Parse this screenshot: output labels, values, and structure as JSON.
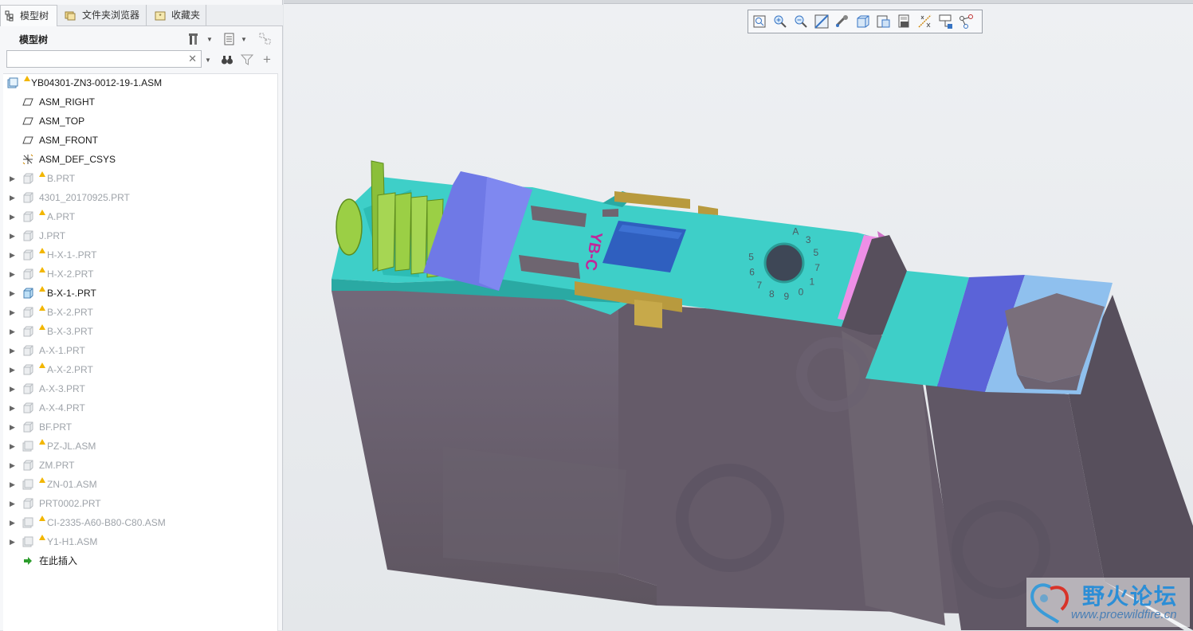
{
  "tabs": [
    {
      "label": "模型树",
      "active": true
    },
    {
      "label": "文件夹浏览器",
      "active": false
    },
    {
      "label": "收藏夹",
      "active": false
    }
  ],
  "panel": {
    "title": "模型树"
  },
  "search": {
    "value": "",
    "placeholder": ""
  },
  "tree": {
    "root": "YB04301-ZN3-0012-19-1.ASM",
    "datums": [
      "ASM_RIGHT",
      "ASM_TOP",
      "ASM_FRONT",
      "ASM_DEF_CSYS"
    ],
    "items": [
      {
        "label": "B.PRT",
        "warn": true,
        "suppressed": true,
        "type": "part"
      },
      {
        "label": "4301_20170925.PRT",
        "warn": false,
        "suppressed": true,
        "type": "part"
      },
      {
        "label": "A.PRT",
        "warn": true,
        "suppressed": true,
        "type": "part"
      },
      {
        "label": "J.PRT",
        "warn": false,
        "suppressed": true,
        "type": "part"
      },
      {
        "label": "H-X-1-.PRT",
        "warn": true,
        "suppressed": true,
        "type": "part"
      },
      {
        "label": "H-X-2.PRT",
        "warn": true,
        "suppressed": true,
        "type": "part"
      },
      {
        "label": "B-X-1-.PRT",
        "warn": true,
        "suppressed": false,
        "type": "part"
      },
      {
        "label": "B-X-2.PRT",
        "warn": true,
        "suppressed": true,
        "type": "part"
      },
      {
        "label": "B-X-3.PRT",
        "warn": true,
        "suppressed": true,
        "type": "part"
      },
      {
        "label": "A-X-1.PRT",
        "warn": false,
        "suppressed": true,
        "type": "part"
      },
      {
        "label": "A-X-2.PRT",
        "warn": true,
        "suppressed": true,
        "type": "part"
      },
      {
        "label": "A-X-3.PRT",
        "warn": false,
        "suppressed": true,
        "type": "part"
      },
      {
        "label": "A-X-4.PRT",
        "warn": false,
        "suppressed": true,
        "type": "part"
      },
      {
        "label": "BF.PRT",
        "warn": false,
        "suppressed": true,
        "type": "part"
      },
      {
        "label": "PZ-JL.ASM",
        "warn": true,
        "suppressed": true,
        "type": "asm"
      },
      {
        "label": "ZM.PRT",
        "warn": false,
        "suppressed": true,
        "type": "part"
      },
      {
        "label": "ZN-01.ASM",
        "warn": true,
        "suppressed": true,
        "type": "asm"
      },
      {
        "label": "PRT0002.PRT",
        "warn": false,
        "suppressed": true,
        "type": "part"
      },
      {
        "label": "CI-2335-A60-B80-C80.ASM",
        "warn": true,
        "suppressed": true,
        "type": "asm"
      },
      {
        "label": "Y1-H1.ASM",
        "warn": true,
        "suppressed": true,
        "type": "asm"
      }
    ],
    "insert_here": "在此插入"
  },
  "model": {
    "engraved_text": "YB-C",
    "dial_labels": [
      "A",
      "3",
      "5",
      "7",
      "1",
      "0",
      "9",
      "8",
      "7",
      "6",
      "5"
    ]
  },
  "watermark": {
    "name": "野火论坛",
    "url": "www.proewildfire.cn"
  },
  "colors": {
    "cyan": "#3ecfc8",
    "body": "#6e6570",
    "blue": "#6f79e6",
    "lightblue": "#8fc0ee",
    "green": "#9bcf45",
    "pink": "#ee8fe6",
    "gold": "#b89a3e",
    "brand_text": "#c0289a"
  }
}
